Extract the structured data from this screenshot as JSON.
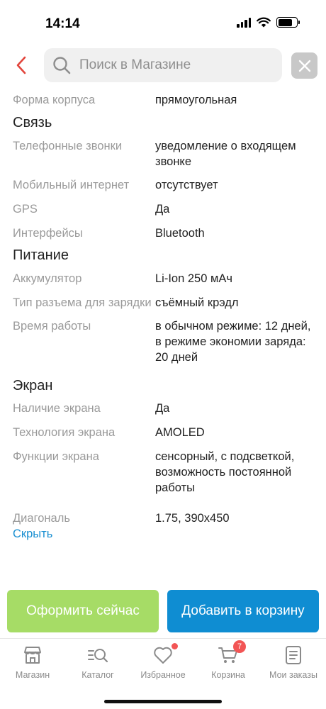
{
  "status_bar": {
    "time": "14:14"
  },
  "search": {
    "placeholder": "Поиск в Магазине",
    "value": ""
  },
  "specs": {
    "top_row": {
      "label": "Форма корпуса",
      "value": "прямоугольная"
    },
    "connectivity": {
      "title": "Связь",
      "rows": [
        {
          "label": "Телефонные звонки",
          "value": "уведомление о входящем звонке"
        },
        {
          "label": "Мобильный интернет",
          "value": "отсутствует"
        },
        {
          "label": "GPS",
          "value": "Да"
        },
        {
          "label": "Интерфейсы",
          "value": "Bluetooth"
        }
      ]
    },
    "power": {
      "title": "Питание",
      "rows": [
        {
          "label": "Аккумулятор",
          "value": "Li-Ion 250 мАч"
        },
        {
          "label": "Тип разъема для зарядки",
          "value": "съёмный крэдл"
        },
        {
          "label": "Время работы",
          "value": "в обычном режиме: 12 дней, в режиме экономии заряда: 20 дней"
        }
      ]
    },
    "screen": {
      "title": "Экран",
      "rows": [
        {
          "label": "Наличие экрана",
          "value": "Да"
        },
        {
          "label": "Технология экрана",
          "value": "AMOLED"
        },
        {
          "label": "Функции экрана",
          "value": "сенсорный, с подсветкой, возможность постоянной работы"
        },
        {
          "label": "Диагональ",
          "value": "1.75, 390x450"
        }
      ]
    },
    "hide_label": "Скрыть"
  },
  "actions": {
    "checkout_label": "Оформить сейчас",
    "add_to_cart_label": "Добавить в корзину"
  },
  "tab_bar": {
    "items": [
      {
        "label": "Магазин",
        "icon": "store-icon"
      },
      {
        "label": "Каталог",
        "icon": "catalog-search-icon"
      },
      {
        "label": "Избранное",
        "icon": "heart-icon"
      },
      {
        "label": "Корзина",
        "icon": "cart-icon",
        "badge": "7"
      },
      {
        "label": "Мои заказы",
        "icon": "orders-icon"
      }
    ]
  },
  "colors": {
    "back_arrow": "#e2453c",
    "checkout_button": "#a6dc66",
    "cart_button": "#0f8dd2",
    "link": "#1a8fd1",
    "badge": "#f25555"
  }
}
